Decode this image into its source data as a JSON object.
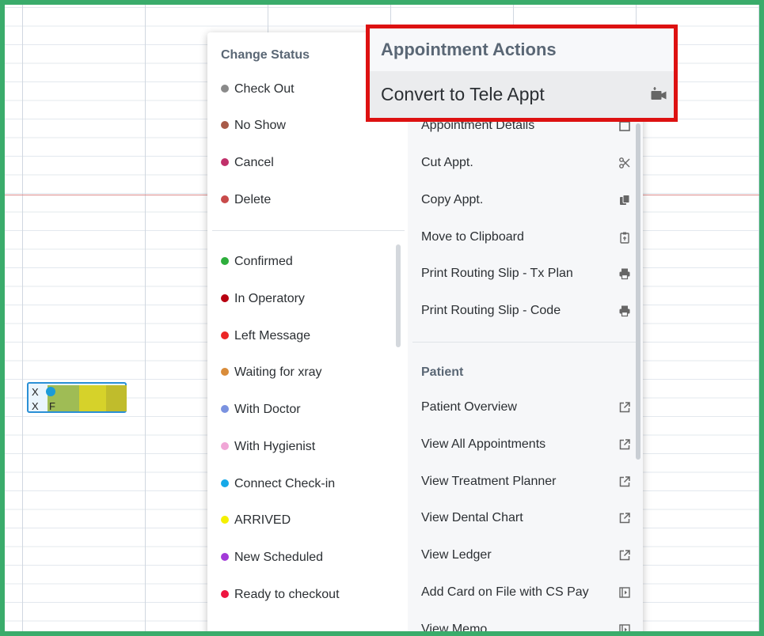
{
  "status_menu": {
    "title": "Change Status",
    "primary": [
      {
        "label": "Check Out",
        "color": "#8a8a8a"
      },
      {
        "label": "No Show",
        "color": "#a85a48"
      },
      {
        "label": "Cancel",
        "color": "#c0306a"
      },
      {
        "label": "Delete",
        "color": "#c84a4a"
      }
    ],
    "statuses": [
      {
        "label": "Confirmed",
        "color": "#2eae3c"
      },
      {
        "label": "In Operatory",
        "color": "#b80010"
      },
      {
        "label": "Left Message",
        "color": "#ec2626"
      },
      {
        "label": "Waiting for xray",
        "color": "#d98c3a"
      },
      {
        "label": "With Doctor",
        "color": "#7a92e0"
      },
      {
        "label": "With Hygienist",
        "color": "#f0a6d6"
      },
      {
        "label": "Connect Check-in",
        "color": "#16a9e8"
      },
      {
        "label": "ARRIVED",
        "color": "#f4f000"
      },
      {
        "label": "New Scheduled",
        "color": "#a23ad8"
      },
      {
        "label": "Ready to checkout",
        "color": "#ee1540"
      }
    ]
  },
  "appointment_menu": {
    "items": [
      {
        "label": "Appointment Details",
        "icon": "open-detail-icon"
      },
      {
        "label": "Cut Appt.",
        "icon": "scissors-icon"
      },
      {
        "label": "Copy Appt.",
        "icon": "copy-icon"
      },
      {
        "label": "Move to Clipboard",
        "icon": "clipboard-icon"
      },
      {
        "label": "Print Routing Slip - Tx Plan",
        "icon": "printer-icon"
      },
      {
        "label": "Print Routing Slip - Code",
        "icon": "printer-icon"
      }
    ],
    "patient_header": "Patient",
    "patient_items": [
      {
        "label": "Patient Overview",
        "icon": "external-link-icon"
      },
      {
        "label": "View All Appointments",
        "icon": "external-link-icon"
      },
      {
        "label": "View Treatment Planner",
        "icon": "external-link-icon"
      },
      {
        "label": "View Dental Chart",
        "icon": "external-link-icon"
      },
      {
        "label": "View Ledger",
        "icon": "external-link-icon"
      },
      {
        "label": "Add Card on File with CS Pay",
        "icon": "panel-open-icon"
      },
      {
        "label": "View Memo",
        "icon": "panel-open-icon"
      }
    ]
  },
  "highlight_popup": {
    "title": "Appointment Actions",
    "item": "Convert to Tele Appt",
    "icon": "video-camera-icon",
    "border_color": "#dd1111"
  },
  "appointment_block": {
    "row1": "X",
    "row2": "X",
    "row2_text": "F"
  }
}
